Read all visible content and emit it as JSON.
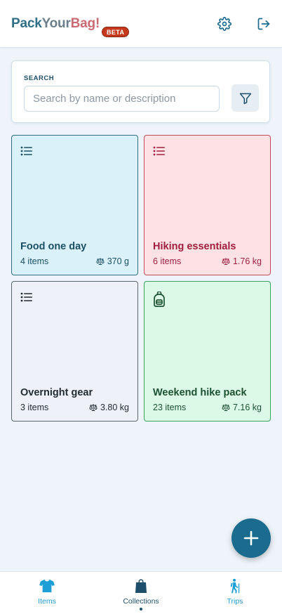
{
  "header": {
    "logo": {
      "part1": "Pack",
      "part2": "Your",
      "part3": "Bag!"
    },
    "badge": "BETA",
    "settings_icon": "gear-icon",
    "logout_icon": "logout-icon"
  },
  "search": {
    "label": "SEARCH",
    "value": "",
    "placeholder": "Search by name or description",
    "filter_icon": "filter-icon"
  },
  "collections": [
    {
      "name": "Food one day",
      "count": "4 items",
      "weight": "370 g",
      "icon": "list-icon",
      "color": "#dbf1f9"
    },
    {
      "name": "Hiking essentials",
      "count": "6 items",
      "weight": "1.76 kg",
      "icon": "list-icon",
      "color": "#fde2e5"
    },
    {
      "name": "Overnight gear",
      "count": "3 items",
      "weight": "3.80 kg",
      "icon": "list-icon",
      "color": "#eef2f8"
    },
    {
      "name": "Weekend hike pack",
      "count": "23 items",
      "weight": "7.16 kg",
      "icon": "backpack-icon",
      "color": "#dcf8e6"
    }
  ],
  "fab": {
    "icon": "plus-icon"
  },
  "nav": {
    "items": [
      {
        "label": "Items",
        "icon": "shirt-icon"
      },
      {
        "label": "Collections",
        "icon": "bag-icon",
        "active": true
      },
      {
        "label": "Trips",
        "icon": "hiker-icon"
      }
    ]
  },
  "colors": {
    "primary": "#1b6b8f",
    "accent": "#1e9ed6",
    "badge": "#c4391c"
  }
}
